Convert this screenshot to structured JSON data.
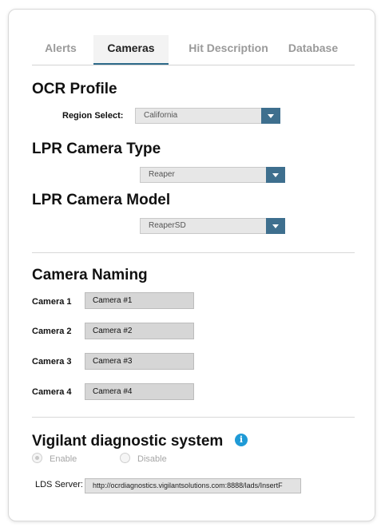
{
  "tabs": [
    "Alerts",
    "Cameras",
    "Hit Description",
    "Database"
  ],
  "active_tab": "Cameras",
  "ocr_profile": {
    "title": "OCR Profile",
    "region_label": "Region Select:",
    "region_value": "California"
  },
  "camera_type": {
    "title": "LPR Camera Type",
    "value": "Reaper"
  },
  "camera_model": {
    "title": "LPR Camera Model",
    "value": "ReaperSD"
  },
  "camera_naming": {
    "title": "Camera Naming",
    "cameras": [
      {
        "label": "Camera 1",
        "value": "Camera #1"
      },
      {
        "label": "Camera 2",
        "value": "Camera #2"
      },
      {
        "label": "Camera 3",
        "value": "Camera #3"
      },
      {
        "label": "Camera 4",
        "value": "Camera #4"
      }
    ]
  },
  "diagnostic": {
    "title": "Vigilant diagnostic system",
    "info_icon": "info-icon",
    "enable_label": "Enable",
    "disable_label": "Disable",
    "selected": "Enable",
    "lds_label": "LDS Server:",
    "lds_value": "http://ocrdiagnostics.vigilantsolutions.com:8888/lads/InsertF"
  },
  "colors": {
    "accent": "#3e6f8e",
    "info": "#1f9ad6",
    "active_tab_border": "#2e6b8a"
  }
}
